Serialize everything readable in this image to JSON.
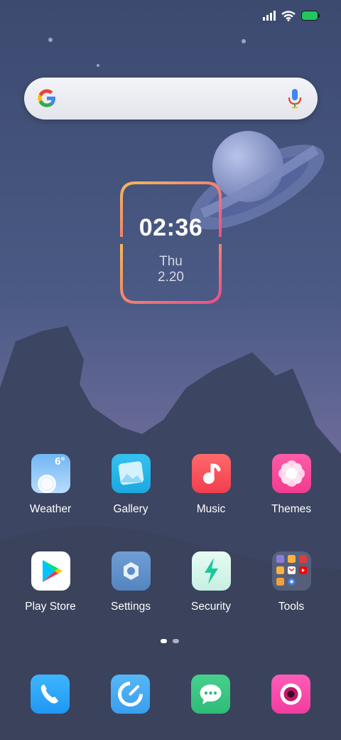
{
  "status_bar": {
    "signal": "signal-icon",
    "wifi": "wifi-icon",
    "battery": "battery-icon",
    "battery_color": "#22c55e"
  },
  "search": {
    "logo": "google-icon",
    "mic": "mic-icon"
  },
  "clock": {
    "time": "02:36",
    "day": "Thu",
    "date": "2.20"
  },
  "weather_temp": "6°",
  "home_apps": [
    {
      "label": "Weather",
      "icon": "weather-icon"
    },
    {
      "label": "Gallery",
      "icon": "gallery-icon"
    },
    {
      "label": "Music",
      "icon": "music-icon"
    },
    {
      "label": "Themes",
      "icon": "themes-icon"
    },
    {
      "label": "Play Store",
      "icon": "play-store-icon"
    },
    {
      "label": "Settings",
      "icon": "settings-icon"
    },
    {
      "label": "Security",
      "icon": "security-icon"
    },
    {
      "label": "Tools",
      "icon": "folder-icon"
    }
  ],
  "dock": [
    {
      "icon": "phone-icon"
    },
    {
      "icon": "browser-icon"
    },
    {
      "icon": "messages-icon"
    },
    {
      "icon": "camera-icon"
    }
  ],
  "colors": {
    "wallpaper_top": "#3c4a70",
    "mountains": "#3a4460",
    "planet": "#8a98c8"
  }
}
